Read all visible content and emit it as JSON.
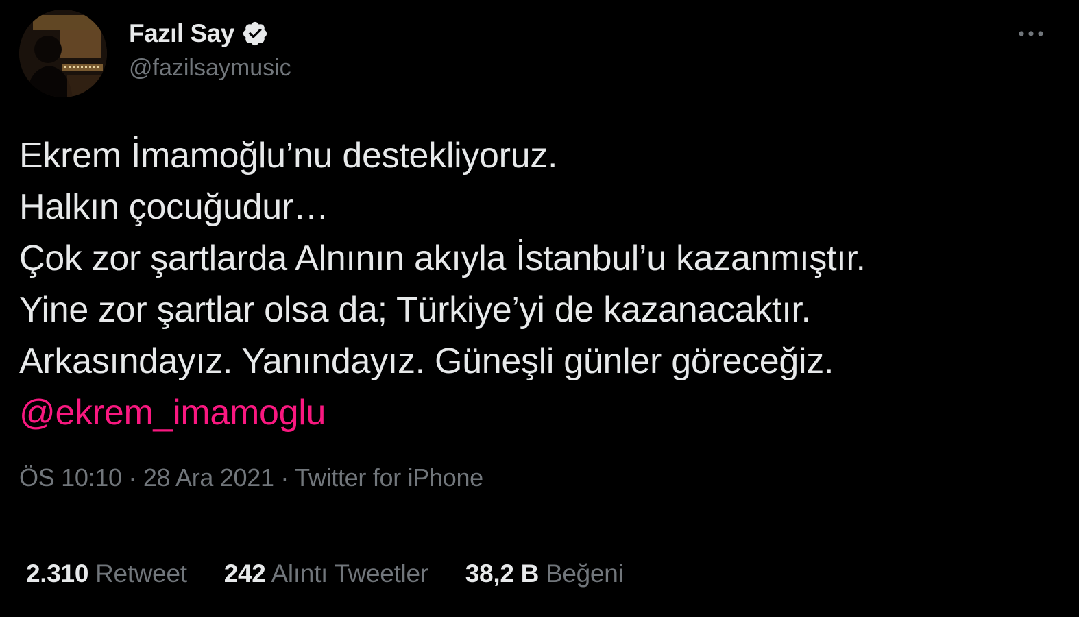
{
  "author": {
    "display_name": "Fazıl Say",
    "handle": "@fazilsaymusic",
    "verified": true,
    "avatar_icon": "profile-photo"
  },
  "tweet": {
    "lines": [
      "Ekrem İmamoğlu’nu destekliyoruz.",
      "Halkın çocuğudur…",
      "Çok zor şartlarda Alnının akıyla İstanbul’u kazanmıştır.",
      "Yine zor şartlar olsa da; Türkiye’yi de kazanacaktır.",
      "Arkasındayız. Yanındayız. Güneşli günler göreceğiz."
    ],
    "mention": "@ekrem_imamoglu"
  },
  "meta": {
    "time": "ÖS 10:10",
    "separator": "·",
    "date": "28 Ara 2021",
    "source": "Twitter for iPhone"
  },
  "stats": {
    "retweets": {
      "value": "2.310",
      "label": "Retweet"
    },
    "quotes": {
      "value": "242",
      "label": "Alıntı Tweetler"
    },
    "likes": {
      "value": "38,2 B",
      "label": "Beğeni"
    }
  },
  "colors": {
    "background": "#000000",
    "primary_text": "#e7e9ea",
    "secondary_text": "#71767b",
    "mention": "#f91880",
    "divider": "#2f3336"
  }
}
